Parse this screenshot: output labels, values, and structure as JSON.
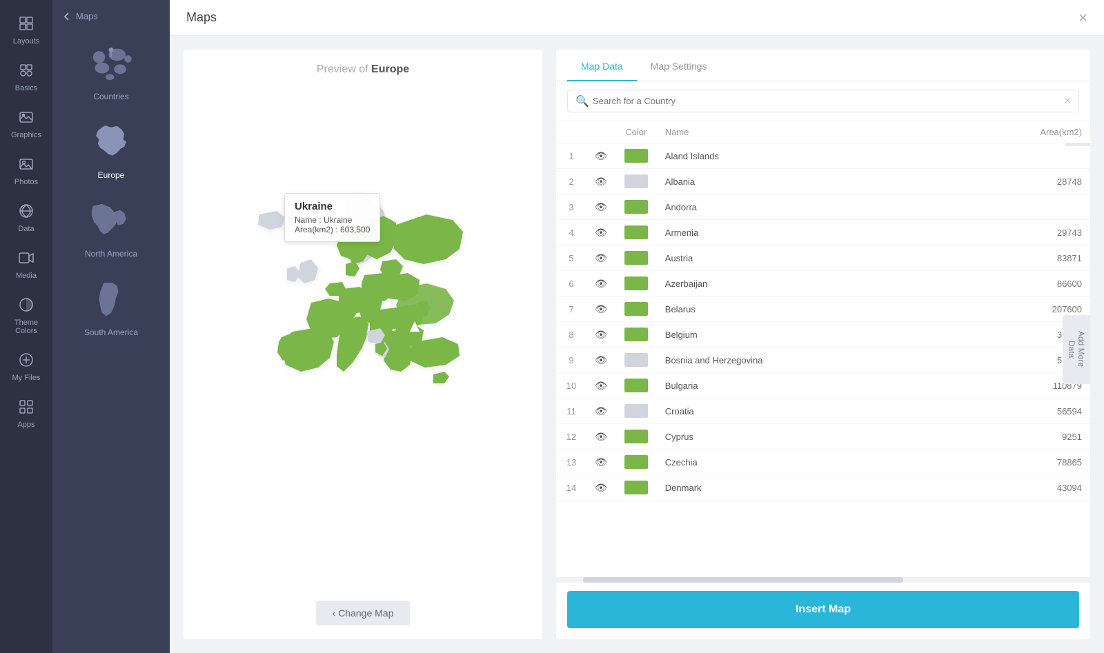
{
  "sidebar": {
    "items": [
      {
        "label": "Layouts",
        "icon": "⊞"
      },
      {
        "label": "Basics",
        "icon": "◈"
      },
      {
        "label": "Graphics",
        "icon": "🖼"
      },
      {
        "label": "Photos",
        "icon": "📷"
      },
      {
        "label": "Data",
        "icon": "📊"
      },
      {
        "label": "Media",
        "icon": "▶"
      },
      {
        "label": "Theme Colors",
        "icon": "🎨"
      },
      {
        "label": "My Files",
        "icon": "＋"
      },
      {
        "label": "Apps",
        "icon": "⊞"
      }
    ]
  },
  "maps_panel": {
    "back_label": "Maps",
    "items": [
      {
        "label": "Countries",
        "active": false
      },
      {
        "label": "Europe",
        "active": true
      },
      {
        "label": "North America",
        "active": false
      },
      {
        "label": "South America",
        "active": false
      }
    ]
  },
  "header": {
    "title": "Maps",
    "close_label": "×"
  },
  "preview": {
    "label_prefix": "Preview of",
    "map_name": "Europe",
    "change_map_label": "‹  Change Map"
  },
  "tooltip": {
    "title": "Ukraine",
    "name_label": "Name : Ukraine",
    "area_label": "Area(km2) : 603,500"
  },
  "tabs": [
    {
      "label": "Map Data",
      "active": true
    },
    {
      "label": "Map Settings",
      "active": false
    }
  ],
  "search": {
    "placeholder": "Search for a Country"
  },
  "table": {
    "headers": [
      "",
      "",
      "Color",
      "Name",
      "Area(km2)"
    ],
    "rows": [
      {
        "num": 1,
        "color": "#7ab648",
        "name": "Aland Islands",
        "area": ""
      },
      {
        "num": 2,
        "color": "#d0d4dc",
        "name": "Albania",
        "area": "28748"
      },
      {
        "num": 3,
        "color": "#7ab648",
        "name": "Andorra",
        "area": ""
      },
      {
        "num": 4,
        "color": "#7ab648",
        "name": "Armenia",
        "area": "29743"
      },
      {
        "num": 5,
        "color": "#7ab648",
        "name": "Austria",
        "area": "83871"
      },
      {
        "num": 6,
        "color": "#7ab648",
        "name": "Azerbaijan",
        "area": "86600"
      },
      {
        "num": 7,
        "color": "#7ab648",
        "name": "Belarus",
        "area": "207600"
      },
      {
        "num": 8,
        "color": "#7ab648",
        "name": "Belgium",
        "area": "30528"
      },
      {
        "num": 9,
        "color": "#d0d4dc",
        "name": "Bosnia and Herzegovina",
        "area": "51209"
      },
      {
        "num": 10,
        "color": "#7ab648",
        "name": "Bulgaria",
        "area": "110879"
      },
      {
        "num": 11,
        "color": "#d0d4dc",
        "name": "Croatia",
        "area": "56594"
      },
      {
        "num": 12,
        "color": "#7ab648",
        "name": "Cyprus",
        "area": "9251"
      },
      {
        "num": 13,
        "color": "#7ab648",
        "name": "Czechia",
        "area": "78865"
      },
      {
        "num": 14,
        "color": "#7ab648",
        "name": "Denmark",
        "area": "43094"
      }
    ]
  },
  "add_more_data_label": "Add More Data",
  "plus_label": "+",
  "insert_map_label": "Insert Map"
}
